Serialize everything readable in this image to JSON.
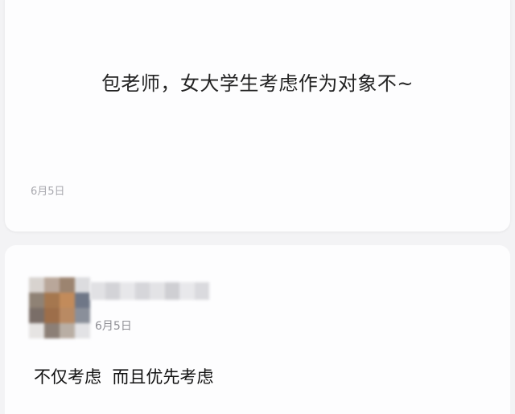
{
  "question": {
    "text": "包老师，女大学生考虑作为对象不~",
    "date": "6月5日"
  },
  "answer": {
    "date": "6月5日",
    "text": "不仅考虑  而且优先考虑"
  },
  "colors": {
    "background": "#f3f3f5",
    "card": "#fdfdfe",
    "date_muted": "#a8a8ae"
  }
}
